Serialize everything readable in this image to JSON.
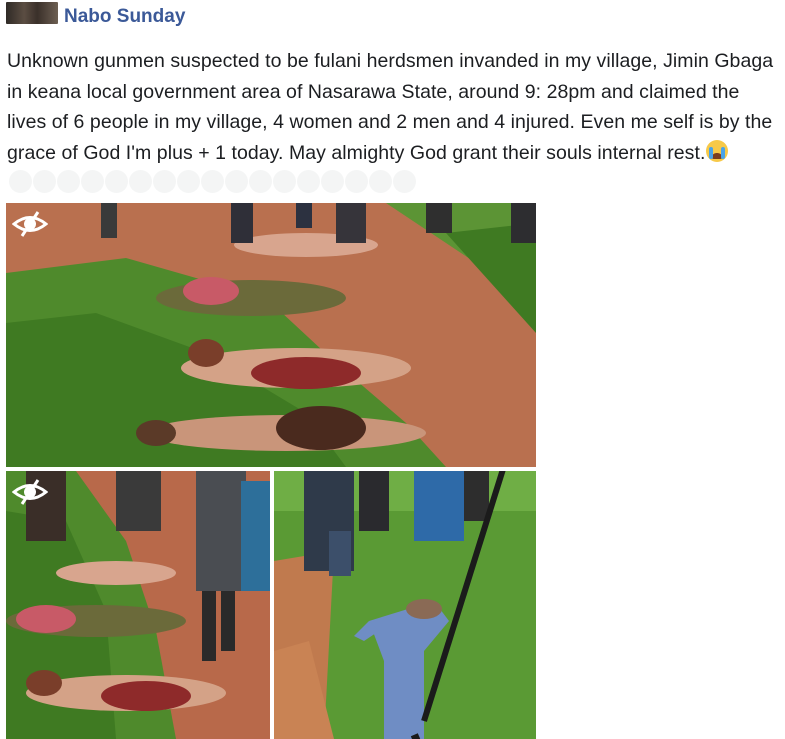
{
  "post": {
    "author": "Nabo Sunday",
    "text": "Unknown gunmen suspected to be fulani herdsmen invanded in my village, Jimin Gbaga in keana local government area of Nasarawa State, around 9: 28pm and claimed the lives of 6 people in my village, 4 women and 2 men and 4 injured. Even me self is by the grace of God I'm plus + 1 today. May almighty God grant their souls internal rest.",
    "emoji": "crying-face",
    "trailing_blank_emoji_count": 17
  },
  "photos": [
    {
      "name": "photo-bodies-on-path",
      "icon": "eye-slash-icon"
    },
    {
      "name": "photo-bodies-closeup",
      "icon": "eye-slash-icon"
    },
    {
      "name": "photo-man-on-grass",
      "icon": ""
    }
  ],
  "colors": {
    "author": "#3b5998",
    "text": "#1c1e21",
    "grass": "#4f8a2c",
    "dirt": "#b0664a"
  }
}
